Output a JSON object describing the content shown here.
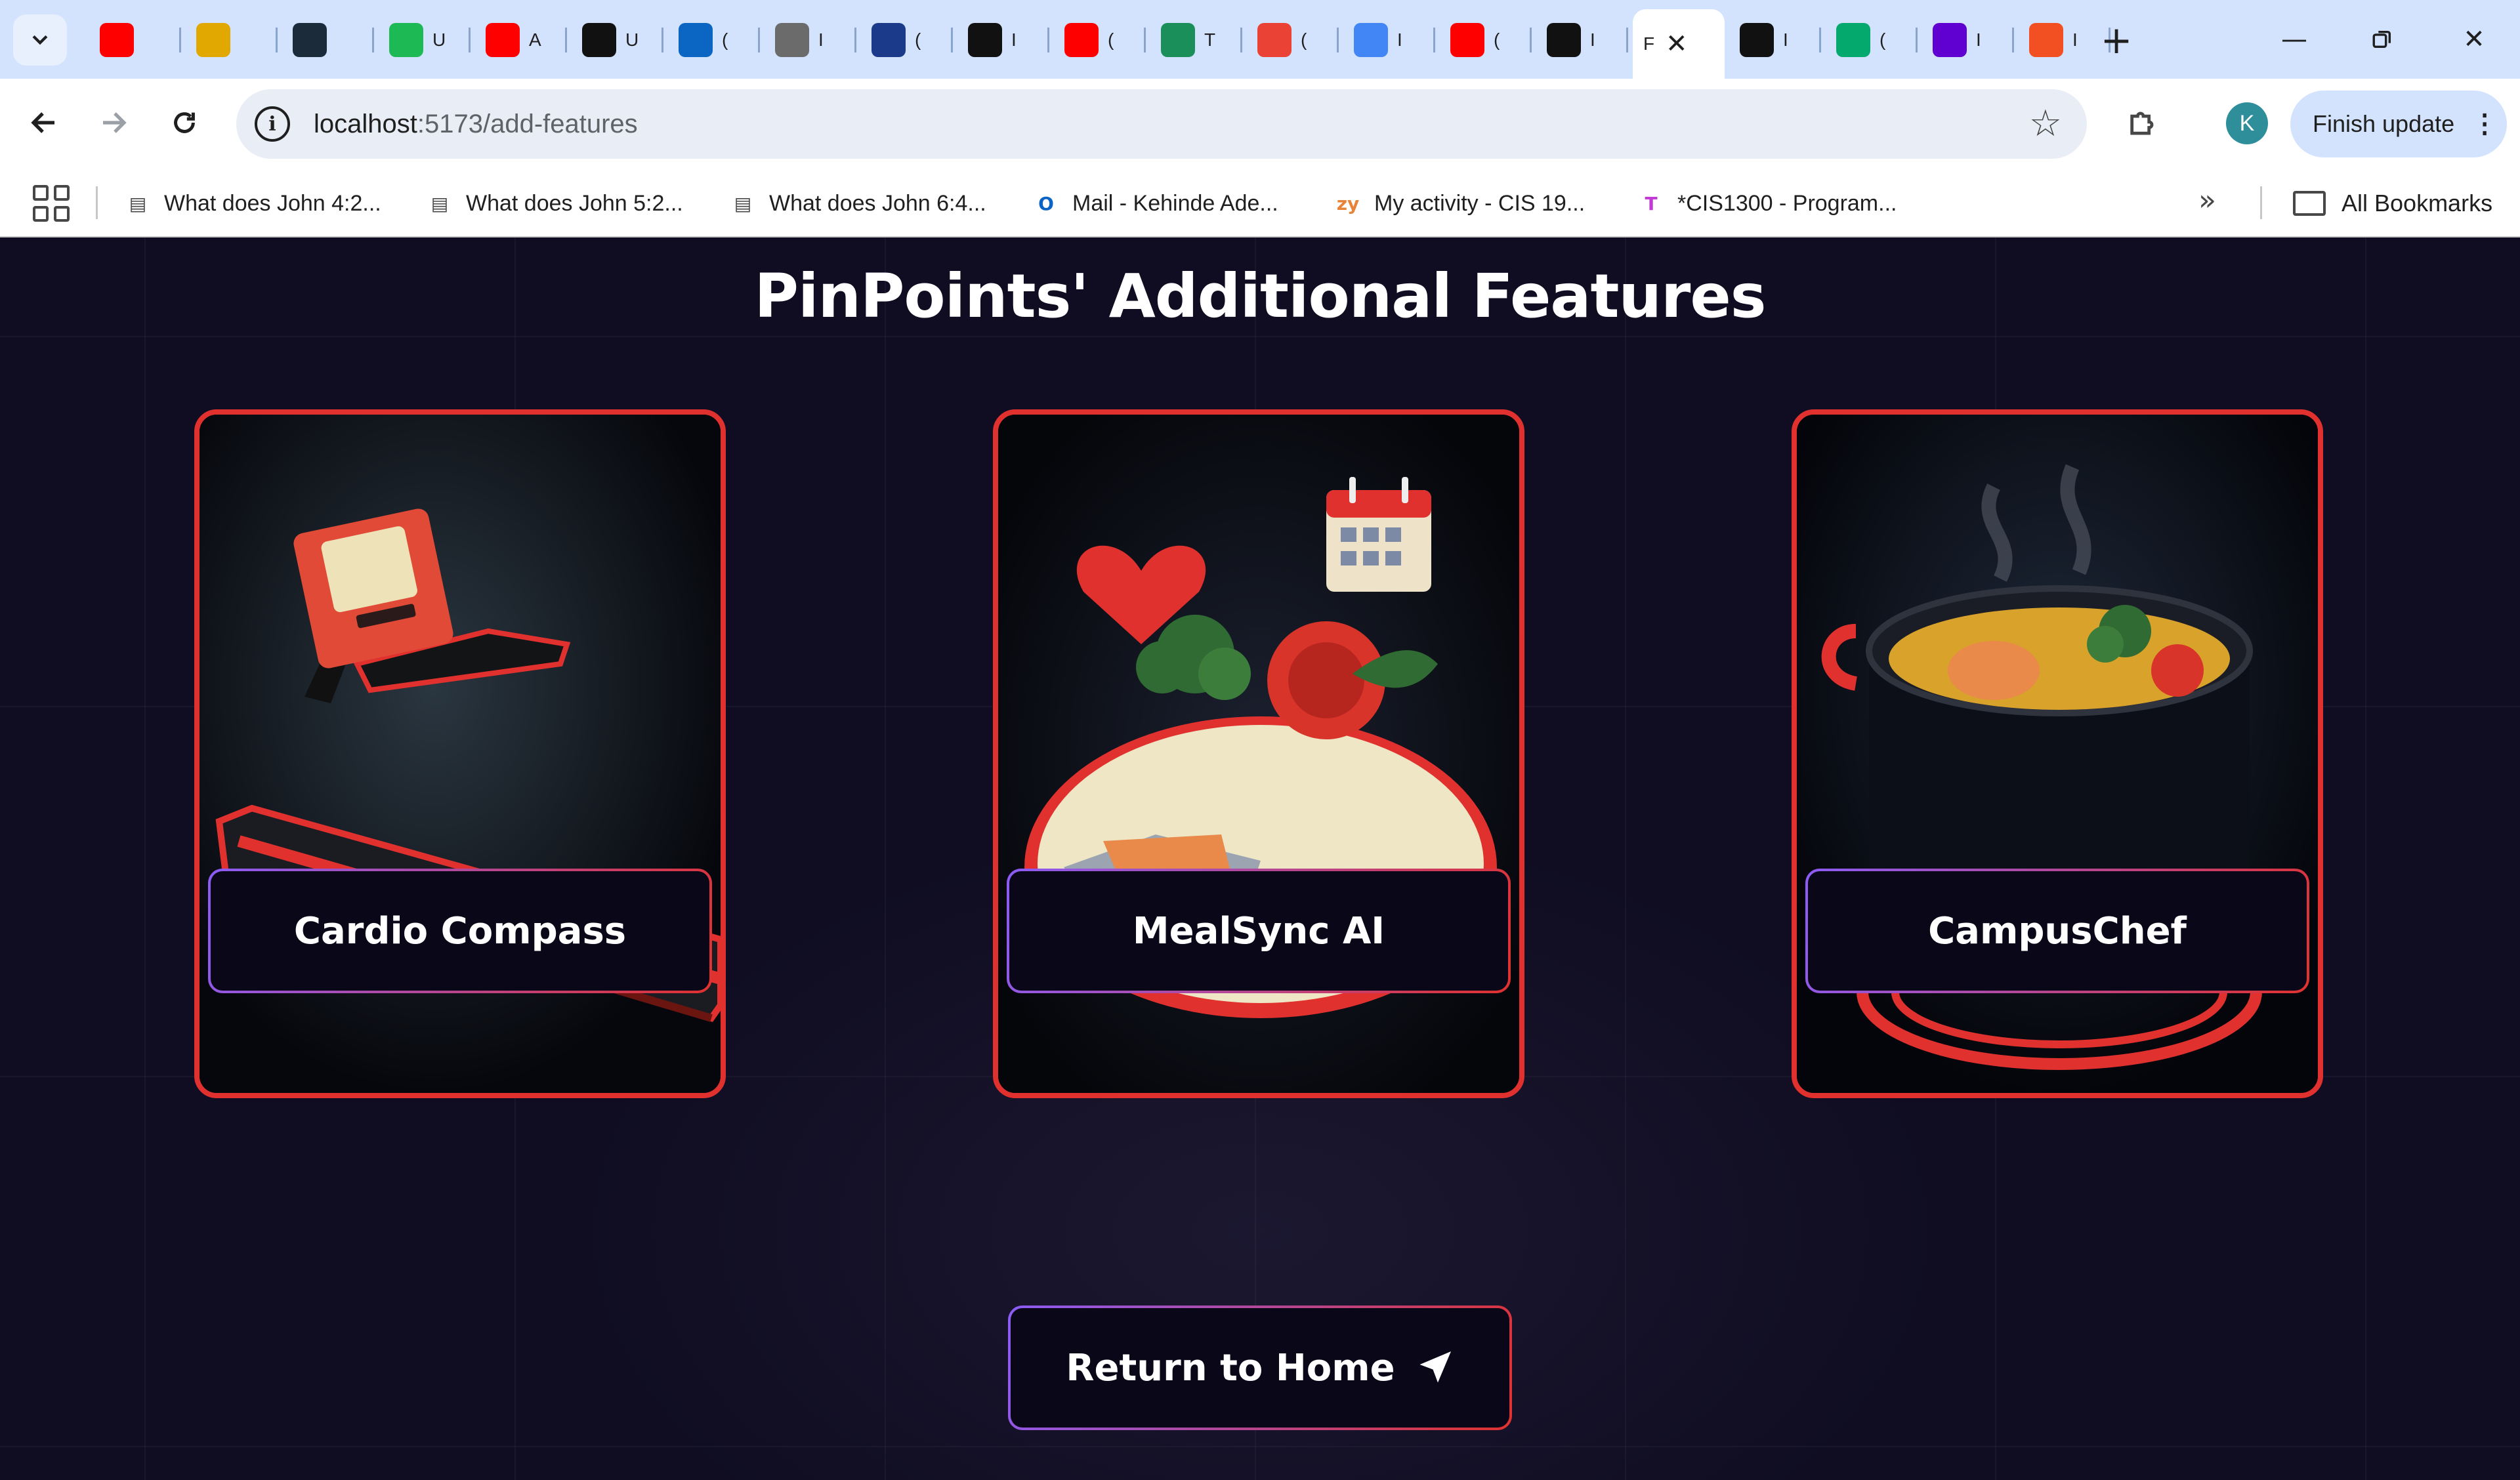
{
  "browser": {
    "tabs": [
      {
        "icon": "youtube-icon",
        "label": "",
        "color": "#ff0000"
      },
      {
        "icon": "money-bag-icon",
        "label": "",
        "color": "#e0a800"
      },
      {
        "icon": "d-logo-icon",
        "label": "",
        "color": "#1c2b3a"
      },
      {
        "icon": "spotify-icon",
        "label": "U",
        "color": "#1db954"
      },
      {
        "icon": "youtube-icon",
        "label": "A",
        "color": "#ff0000"
      },
      {
        "icon": "g-logo-icon",
        "label": "U",
        "color": "#111111"
      },
      {
        "icon": "linkedin-icon",
        "label": "(",
        "color": "#0a66c2"
      },
      {
        "icon": "globe-icon",
        "label": "I",
        "color": "#6b6b6b"
      },
      {
        "icon": "disney-plus-icon",
        "label": "(",
        "color": "#1b3a8a"
      },
      {
        "icon": "github-icon",
        "label": "I",
        "color": "#111111"
      },
      {
        "icon": "youtube-icon",
        "label": "(",
        "color": "#ff0000"
      },
      {
        "icon": "graduation-cap-icon",
        "label": "T",
        "color": "#1a8f5a"
      },
      {
        "icon": "notification-54-icon",
        "label": "(",
        "color": "#ea4335"
      },
      {
        "icon": "docs-icon",
        "label": "I",
        "color": "#4285f4"
      },
      {
        "icon": "youtube-icon",
        "label": "(",
        "color": "#ff0000"
      },
      {
        "icon": "github-icon",
        "label": "I",
        "color": "#111111"
      },
      {
        "icon": "active-tab",
        "label": "F",
        "color": "#ffffff"
      },
      {
        "icon": "openai-icon",
        "label": "I",
        "color": "#111111"
      },
      {
        "icon": "w3schools-icon",
        "label": "(",
        "color": "#04aa6d"
      },
      {
        "icon": "yahoo-icon",
        "label": "I",
        "color": "#6001d2"
      },
      {
        "icon": "microsoft-icon",
        "label": "I",
        "color": "#f25022"
      }
    ],
    "url_host": "localhost",
    "url_path": ":5173/add-features",
    "avatar_letter": "K",
    "finish_update": "Finish update",
    "bookmarks": [
      {
        "label": "What does John 4:2...",
        "icon": "bookmark-page-icon"
      },
      {
        "label": "What does John 5:2...",
        "icon": "bookmark-page-icon"
      },
      {
        "label": "What does John 6:4...",
        "icon": "bookmark-page-icon"
      },
      {
        "label": "Mail - Kehinde Ade...",
        "icon": "outlook-icon"
      },
      {
        "label": "My activity - CIS 19...",
        "icon": "zybooks-icon"
      },
      {
        "label": "*CIS1300 - Program...",
        "icon": "t-logo-icon"
      }
    ],
    "all_bookmarks": "All Bookmarks"
  },
  "page": {
    "title": "PinPoints' Additional Features",
    "cards": [
      {
        "label": "Cardio Compass"
      },
      {
        "label": "MealSync AI"
      },
      {
        "label": "CampusChef"
      }
    ],
    "return_button": "Return to Home"
  },
  "colors": {
    "background": "#100d22",
    "card_border": "#e0312f",
    "accent_purple": "#8b5cf6",
    "tabstrip": "#d3e3fd"
  }
}
